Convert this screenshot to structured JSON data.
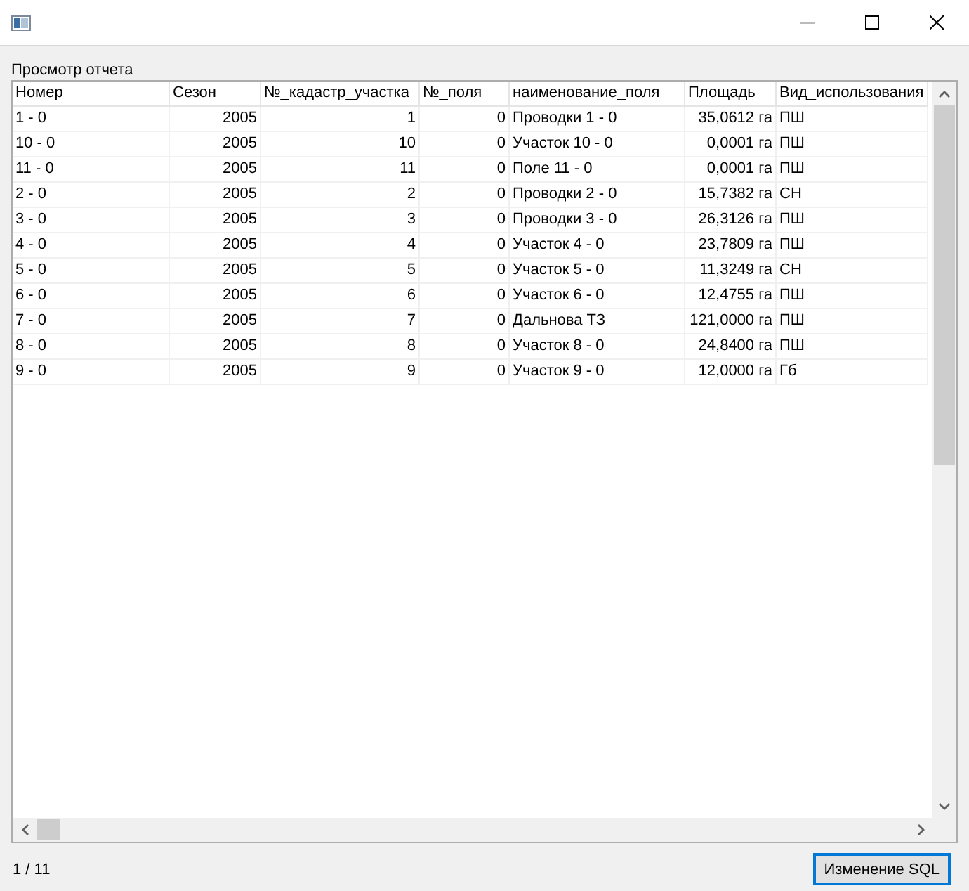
{
  "report": {
    "label": "Просмотр отчета",
    "columns": [
      {
        "title": "Номер",
        "kind": "text"
      },
      {
        "title": "Сезон",
        "kind": "number"
      },
      {
        "title": "№_кадастр_участка",
        "kind": "number"
      },
      {
        "title": "№_поля",
        "kind": "number"
      },
      {
        "title": "наименование_поля",
        "kind": "text"
      },
      {
        "title": "Площадь",
        "kind": "number"
      },
      {
        "title": "Вид_использования",
        "kind": "text"
      }
    ],
    "rows": [
      [
        "1 - 0",
        "2005",
        "1",
        "0",
        "Проводки 1 - 0",
        "35,0612 га",
        "ПШ"
      ],
      [
        "10 - 0",
        "2005",
        "10",
        "0",
        "Участок 10 - 0",
        "0,0001 га",
        "ПШ"
      ],
      [
        "11 - 0",
        "2005",
        "11",
        "0",
        "Поле 11 - 0",
        "0,0001 га",
        "ПШ"
      ],
      [
        "2 - 0",
        "2005",
        "2",
        "0",
        "Проводки 2 - 0",
        "15,7382 га",
        "СН"
      ],
      [
        "3 - 0",
        "2005",
        "3",
        "0",
        "Проводки 3 - 0",
        "26,3126 га",
        "ПШ"
      ],
      [
        "4 - 0",
        "2005",
        "4",
        "0",
        "Участок 4 - 0",
        "23,7809 га",
        "ПШ"
      ],
      [
        "5 - 0",
        "2005",
        "5",
        "0",
        "Участок 5 - 0",
        "11,3249 га",
        "СН"
      ],
      [
        "6 - 0",
        "2005",
        "6",
        "0",
        "Участок 6 - 0",
        "12,4755 га",
        "ПШ"
      ],
      [
        "7 - 0",
        "2005",
        "7",
        "0",
        "Дальнова ТЗ",
        "121,0000 га",
        "ПШ"
      ],
      [
        "8 - 0",
        "2005",
        "8",
        "0",
        "Участок 8 - 0",
        "24,8400 га",
        "ПШ"
      ],
      [
        "9 - 0",
        "2005",
        "9",
        "0",
        "Участок 9 - 0",
        "12,0000 га",
        "Гб"
      ]
    ]
  },
  "status": {
    "record_counter": "1 / 11",
    "button": "Изменение SQL"
  }
}
